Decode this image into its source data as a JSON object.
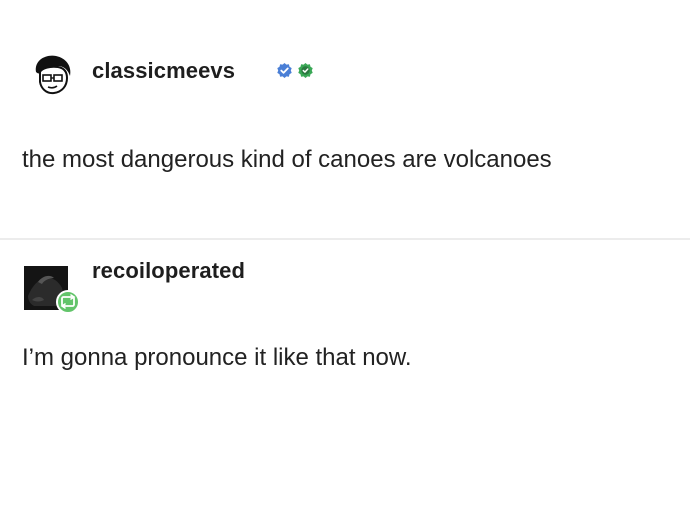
{
  "posts": [
    {
      "username": "classicmeevs",
      "avatar_icon": "cartoon-face-avatar-icon",
      "badges": [
        "blue-verified-badge-icon",
        "green-check-badge-icon"
      ],
      "badge_colors": {
        "blue": "#4a7fd6",
        "green": "#3aa856"
      },
      "text": "the most dangerous kind of canoes are volcanoes"
    },
    {
      "username": "recoiloperated",
      "avatar_icon": "dark-photo-avatar-icon",
      "reblog_icon": "green-reblog-badge-icon",
      "reblog_color": "#62c46a",
      "text": "I’m gonna pronounce it like that now."
    }
  ]
}
